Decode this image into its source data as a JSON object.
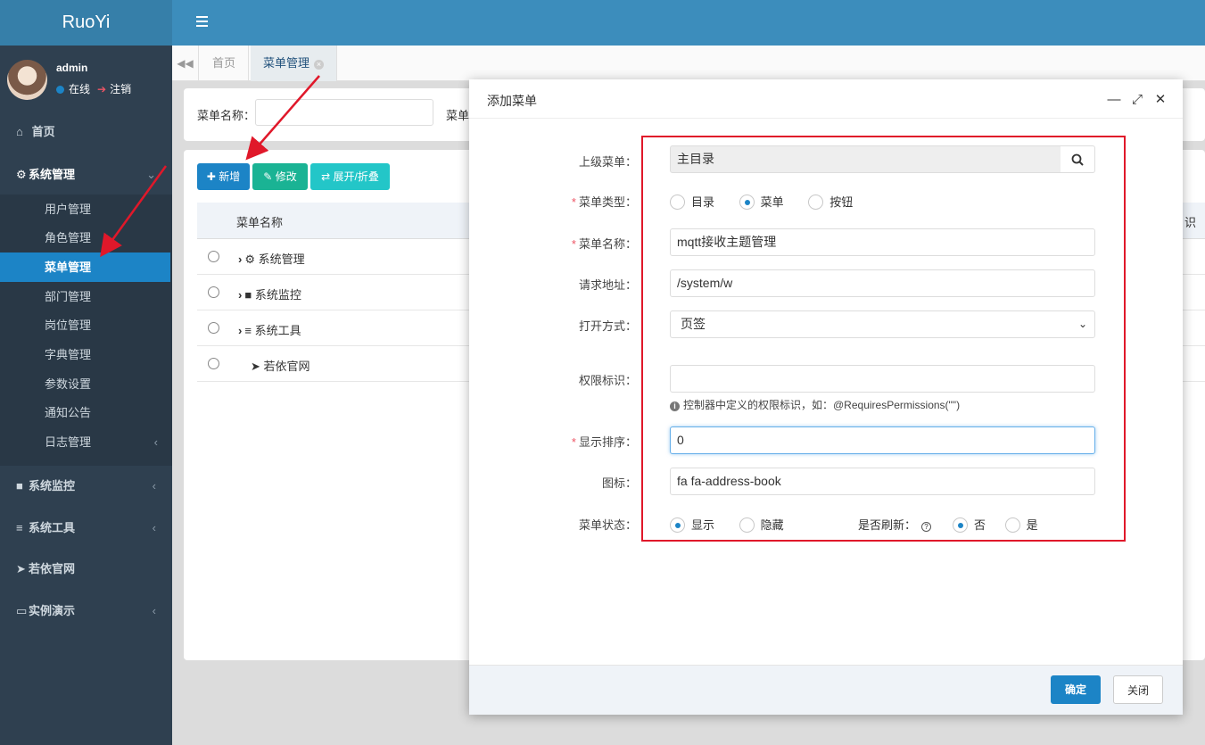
{
  "app": {
    "logo": "RuoYi"
  },
  "user": {
    "name": "admin",
    "status": "在线",
    "logout": "注销"
  },
  "sidebar": {
    "home": "首页",
    "system": "系统管理",
    "submenu": [
      "用户管理",
      "角色管理",
      "菜单管理",
      "部门管理",
      "岗位管理",
      "字典管理",
      "参数设置",
      "通知公告",
      "日志管理"
    ],
    "monitor": "系统监控",
    "tools": "系统工具",
    "site": "若依官网",
    "demo": "实例演示"
  },
  "tabs": [
    {
      "label": "首页"
    },
    {
      "label": "菜单管理"
    }
  ],
  "search": {
    "label": "菜单名称：",
    "label2": "菜单"
  },
  "toolbar": {
    "add": "新增",
    "edit": "修改",
    "expand": "展开/折叠"
  },
  "table": {
    "header": "菜单名称",
    "header2": "识",
    "rows": [
      "系统管理",
      "系统监控",
      "系统工具",
      "若依官网"
    ]
  },
  "modal": {
    "title": "添加菜单",
    "fields": {
      "parent_label": "上级菜单：",
      "parent_value": "主目录",
      "type_label": "菜单类型：",
      "type_options": [
        "目录",
        "菜单",
        "按钮"
      ],
      "type_selected": "菜单",
      "name_label": "菜单名称：",
      "name_value": "mqtt接收主题管理",
      "url_label": "请求地址：",
      "url_value": "/system/w",
      "target_label": "打开方式：",
      "target_value": "页签",
      "perms_label": "权限标识：",
      "perms_value": "",
      "perms_help": "控制器中定义的权限标识，如：@RequiresPermissions(\"\")",
      "order_label": "显示排序：",
      "order_value": "0",
      "icon_label": "图标：",
      "icon_value": "fa fa-address-book",
      "visible_label": "菜单状态：",
      "visible_options": [
        "显示",
        "隐藏"
      ],
      "refresh_label": "是否刷新：",
      "refresh_options": [
        "否",
        "是"
      ]
    },
    "ok": "确定",
    "close": "关闭"
  },
  "colors": {
    "primary": "#1c84c6",
    "success": "#1ab394",
    "info": "#23c6c8",
    "sidebar": "#2f4050",
    "topbar": "#3c8dbc",
    "annotation": "#e0182a"
  }
}
